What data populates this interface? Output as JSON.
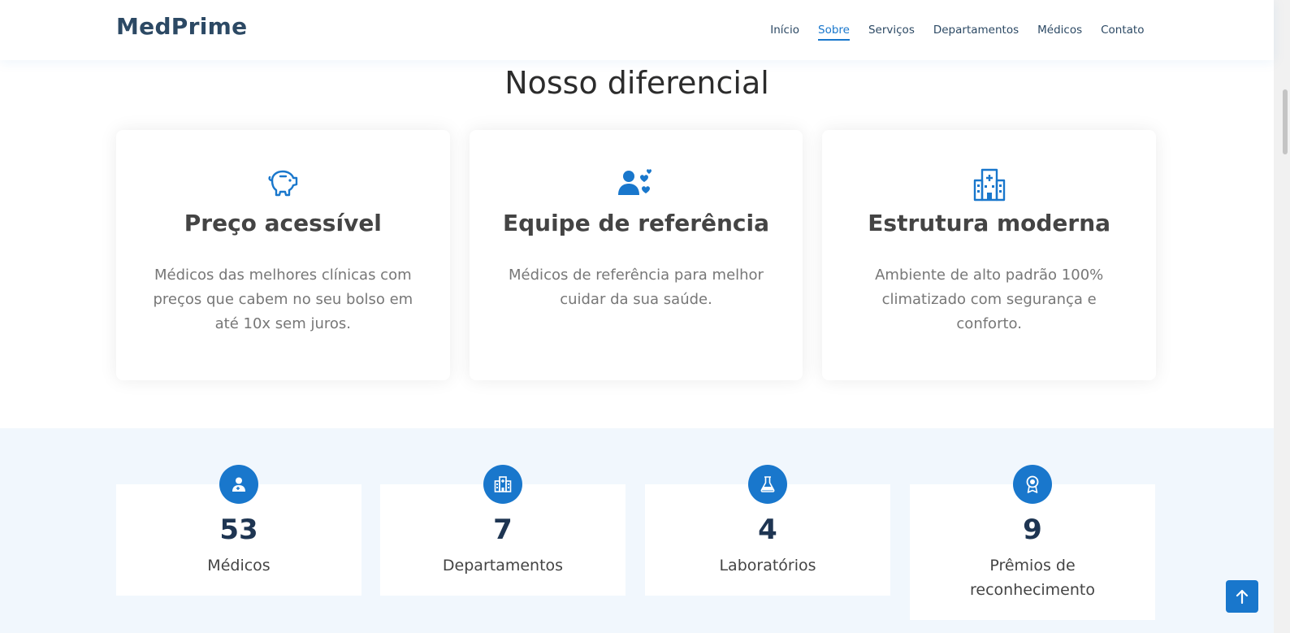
{
  "header": {
    "logo": "MedPrime",
    "nav": [
      {
        "label": "Início",
        "active": false
      },
      {
        "label": "Sobre",
        "active": true
      },
      {
        "label": "Serviços",
        "active": false
      },
      {
        "label": "Departamentos",
        "active": false
      },
      {
        "label": "Médicos",
        "active": false
      },
      {
        "label": "Contato",
        "active": false
      }
    ]
  },
  "features": {
    "title": "Nosso diferencial",
    "cards": [
      {
        "icon": "piggy-bank-icon",
        "title": "Preço acessível",
        "text": "Médicos das melhores clínicas com preços que cabem no seu bolso em até 10x sem juros."
      },
      {
        "icon": "user-hearts-icon",
        "title": "Equipe de referência",
        "text": "Médicos de referência para melhor cuidar da sua saúde."
      },
      {
        "icon": "hospital-icon",
        "title": "Estrutura moderna",
        "text": "Ambiente de alto padrão 100% climatizado com segurança e conforto."
      }
    ]
  },
  "counts": [
    {
      "icon": "doctor-icon",
      "number": "53",
      "label": "Médicos"
    },
    {
      "icon": "building-icon",
      "number": "7",
      "label": "Departamentos"
    },
    {
      "icon": "flask-icon",
      "number": "4",
      "label": "Laboratórios"
    },
    {
      "icon": "award-icon",
      "number": "9",
      "label": "Prêmios de reconhecimento"
    }
  ],
  "colors": {
    "accent": "#1977cc",
    "heading": "#2c4964",
    "counts_bg": "#f1f7fd"
  },
  "back_to_top": {
    "icon": "arrow-up-icon"
  }
}
